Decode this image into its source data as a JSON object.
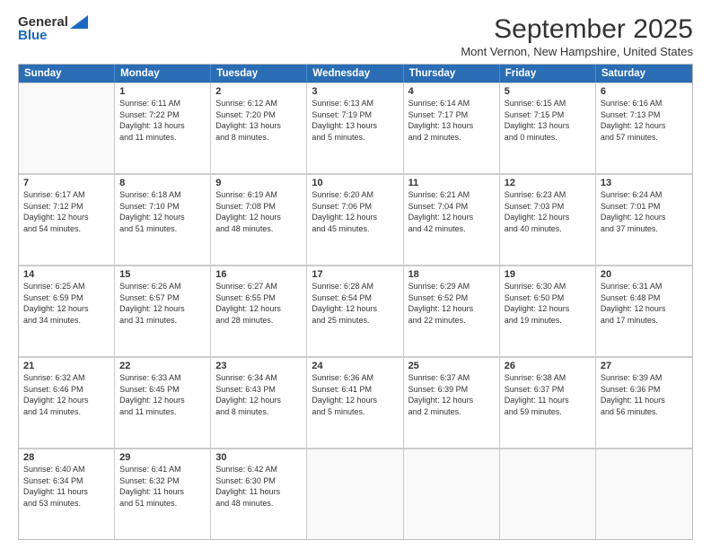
{
  "logo": {
    "general": "General",
    "blue": "Blue"
  },
  "title": "September 2025",
  "subtitle": "Mont Vernon, New Hampshire, United States",
  "header_days": [
    "Sunday",
    "Monday",
    "Tuesday",
    "Wednesday",
    "Thursday",
    "Friday",
    "Saturday"
  ],
  "weeks": [
    [
      {
        "day": "",
        "info": ""
      },
      {
        "day": "1",
        "info": "Sunrise: 6:11 AM\nSunset: 7:22 PM\nDaylight: 13 hours\nand 11 minutes."
      },
      {
        "day": "2",
        "info": "Sunrise: 6:12 AM\nSunset: 7:20 PM\nDaylight: 13 hours\nand 8 minutes."
      },
      {
        "day": "3",
        "info": "Sunrise: 6:13 AM\nSunset: 7:19 PM\nDaylight: 13 hours\nand 5 minutes."
      },
      {
        "day": "4",
        "info": "Sunrise: 6:14 AM\nSunset: 7:17 PM\nDaylight: 13 hours\nand 2 minutes."
      },
      {
        "day": "5",
        "info": "Sunrise: 6:15 AM\nSunset: 7:15 PM\nDaylight: 13 hours\nand 0 minutes."
      },
      {
        "day": "6",
        "info": "Sunrise: 6:16 AM\nSunset: 7:13 PM\nDaylight: 12 hours\nand 57 minutes."
      }
    ],
    [
      {
        "day": "7",
        "info": "Sunrise: 6:17 AM\nSunset: 7:12 PM\nDaylight: 12 hours\nand 54 minutes."
      },
      {
        "day": "8",
        "info": "Sunrise: 6:18 AM\nSunset: 7:10 PM\nDaylight: 12 hours\nand 51 minutes."
      },
      {
        "day": "9",
        "info": "Sunrise: 6:19 AM\nSunset: 7:08 PM\nDaylight: 12 hours\nand 48 minutes."
      },
      {
        "day": "10",
        "info": "Sunrise: 6:20 AM\nSunset: 7:06 PM\nDaylight: 12 hours\nand 45 minutes."
      },
      {
        "day": "11",
        "info": "Sunrise: 6:21 AM\nSunset: 7:04 PM\nDaylight: 12 hours\nand 42 minutes."
      },
      {
        "day": "12",
        "info": "Sunrise: 6:23 AM\nSunset: 7:03 PM\nDaylight: 12 hours\nand 40 minutes."
      },
      {
        "day": "13",
        "info": "Sunrise: 6:24 AM\nSunset: 7:01 PM\nDaylight: 12 hours\nand 37 minutes."
      }
    ],
    [
      {
        "day": "14",
        "info": "Sunrise: 6:25 AM\nSunset: 6:59 PM\nDaylight: 12 hours\nand 34 minutes."
      },
      {
        "day": "15",
        "info": "Sunrise: 6:26 AM\nSunset: 6:57 PM\nDaylight: 12 hours\nand 31 minutes."
      },
      {
        "day": "16",
        "info": "Sunrise: 6:27 AM\nSunset: 6:55 PM\nDaylight: 12 hours\nand 28 minutes."
      },
      {
        "day": "17",
        "info": "Sunrise: 6:28 AM\nSunset: 6:54 PM\nDaylight: 12 hours\nand 25 minutes."
      },
      {
        "day": "18",
        "info": "Sunrise: 6:29 AM\nSunset: 6:52 PM\nDaylight: 12 hours\nand 22 minutes."
      },
      {
        "day": "19",
        "info": "Sunrise: 6:30 AM\nSunset: 6:50 PM\nDaylight: 12 hours\nand 19 minutes."
      },
      {
        "day": "20",
        "info": "Sunrise: 6:31 AM\nSunset: 6:48 PM\nDaylight: 12 hours\nand 17 minutes."
      }
    ],
    [
      {
        "day": "21",
        "info": "Sunrise: 6:32 AM\nSunset: 6:46 PM\nDaylight: 12 hours\nand 14 minutes."
      },
      {
        "day": "22",
        "info": "Sunrise: 6:33 AM\nSunset: 6:45 PM\nDaylight: 12 hours\nand 11 minutes."
      },
      {
        "day": "23",
        "info": "Sunrise: 6:34 AM\nSunset: 6:43 PM\nDaylight: 12 hours\nand 8 minutes."
      },
      {
        "day": "24",
        "info": "Sunrise: 6:36 AM\nSunset: 6:41 PM\nDaylight: 12 hours\nand 5 minutes."
      },
      {
        "day": "25",
        "info": "Sunrise: 6:37 AM\nSunset: 6:39 PM\nDaylight: 12 hours\nand 2 minutes."
      },
      {
        "day": "26",
        "info": "Sunrise: 6:38 AM\nSunset: 6:37 PM\nDaylight: 11 hours\nand 59 minutes."
      },
      {
        "day": "27",
        "info": "Sunrise: 6:39 AM\nSunset: 6:36 PM\nDaylight: 11 hours\nand 56 minutes."
      }
    ],
    [
      {
        "day": "28",
        "info": "Sunrise: 6:40 AM\nSunset: 6:34 PM\nDaylight: 11 hours\nand 53 minutes."
      },
      {
        "day": "29",
        "info": "Sunrise: 6:41 AM\nSunset: 6:32 PM\nDaylight: 11 hours\nand 51 minutes."
      },
      {
        "day": "30",
        "info": "Sunrise: 6:42 AM\nSunset: 6:30 PM\nDaylight: 11 hours\nand 48 minutes."
      },
      {
        "day": "",
        "info": ""
      },
      {
        "day": "",
        "info": ""
      },
      {
        "day": "",
        "info": ""
      },
      {
        "day": "",
        "info": ""
      }
    ]
  ]
}
